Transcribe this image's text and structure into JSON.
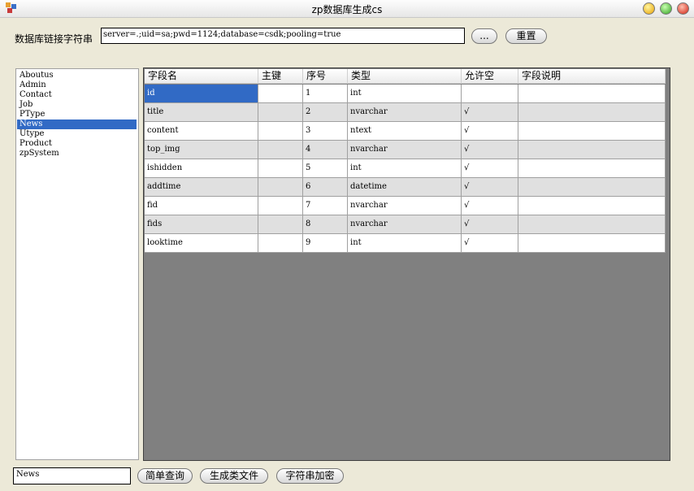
{
  "window": {
    "title": "zp数据库生成cs",
    "icon": "app-icon"
  },
  "connection": {
    "label": "数据库链接字符串",
    "value": "server=.;uid=sa;pwd=1124;database=csdk;pooling=true",
    "browse_label": "...",
    "reset_label": "重置"
  },
  "tables": {
    "items": [
      "Aboutus",
      "Admin",
      "Contact",
      "Job",
      "PType",
      "News",
      "Utype",
      "Product",
      "zpSystem"
    ],
    "selected": "News"
  },
  "grid": {
    "columns": [
      "字段名",
      "主键",
      "序号",
      "类型",
      "允许空",
      "字段说明"
    ],
    "rows": [
      [
        "id",
        "",
        "1",
        "int",
        "",
        ""
      ],
      [
        "title",
        "",
        "2",
        "nvarchar",
        "√",
        ""
      ],
      [
        "content",
        "",
        "3",
        "ntext",
        "√",
        ""
      ],
      [
        "top_img",
        "",
        "4",
        "nvarchar",
        "√",
        ""
      ],
      [
        "ishidden",
        "",
        "5",
        "int",
        "√",
        ""
      ],
      [
        "addtime",
        "",
        "6",
        "datetime",
        "√",
        ""
      ],
      [
        "fid",
        "",
        "7",
        "nvarchar",
        "√",
        ""
      ],
      [
        "fids",
        "",
        "8",
        "nvarchar",
        "√",
        ""
      ],
      [
        "looktime",
        "",
        "9",
        "int",
        "√",
        ""
      ]
    ]
  },
  "bottom": {
    "table_name": "News",
    "query_label": "简单查询",
    "generate_label": "生成类文件",
    "encrypt_label": "字符串加密"
  },
  "colors": {
    "selection": "#316ac5",
    "grid_bg": "#808080",
    "alt_row": "#e0e0e0"
  }
}
